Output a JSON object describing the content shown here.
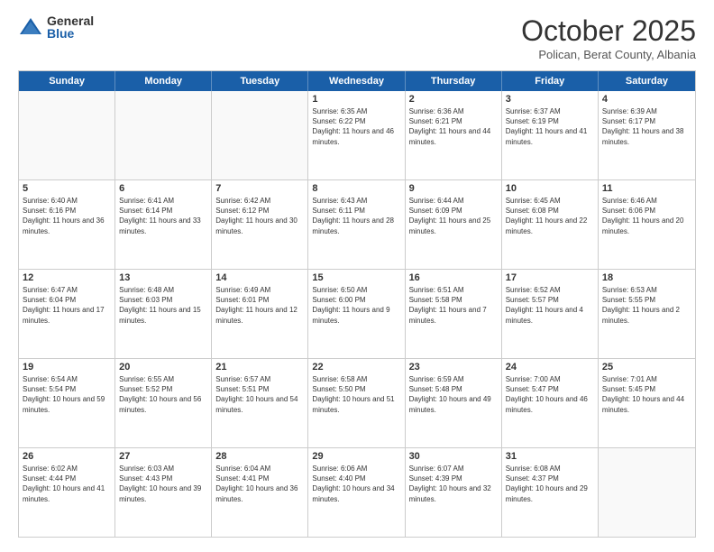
{
  "logo": {
    "general": "General",
    "blue": "Blue"
  },
  "header": {
    "month": "October 2025",
    "location": "Polican, Berat County, Albania"
  },
  "weekdays": [
    "Sunday",
    "Monday",
    "Tuesday",
    "Wednesday",
    "Thursday",
    "Friday",
    "Saturday"
  ],
  "rows": [
    [
      {
        "day": "",
        "info": ""
      },
      {
        "day": "",
        "info": ""
      },
      {
        "day": "",
        "info": ""
      },
      {
        "day": "1",
        "info": "Sunrise: 6:35 AM\nSunset: 6:22 PM\nDaylight: 11 hours and 46 minutes."
      },
      {
        "day": "2",
        "info": "Sunrise: 6:36 AM\nSunset: 6:21 PM\nDaylight: 11 hours and 44 minutes."
      },
      {
        "day": "3",
        "info": "Sunrise: 6:37 AM\nSunset: 6:19 PM\nDaylight: 11 hours and 41 minutes."
      },
      {
        "day": "4",
        "info": "Sunrise: 6:39 AM\nSunset: 6:17 PM\nDaylight: 11 hours and 38 minutes."
      }
    ],
    [
      {
        "day": "5",
        "info": "Sunrise: 6:40 AM\nSunset: 6:16 PM\nDaylight: 11 hours and 36 minutes."
      },
      {
        "day": "6",
        "info": "Sunrise: 6:41 AM\nSunset: 6:14 PM\nDaylight: 11 hours and 33 minutes."
      },
      {
        "day": "7",
        "info": "Sunrise: 6:42 AM\nSunset: 6:12 PM\nDaylight: 11 hours and 30 minutes."
      },
      {
        "day": "8",
        "info": "Sunrise: 6:43 AM\nSunset: 6:11 PM\nDaylight: 11 hours and 28 minutes."
      },
      {
        "day": "9",
        "info": "Sunrise: 6:44 AM\nSunset: 6:09 PM\nDaylight: 11 hours and 25 minutes."
      },
      {
        "day": "10",
        "info": "Sunrise: 6:45 AM\nSunset: 6:08 PM\nDaylight: 11 hours and 22 minutes."
      },
      {
        "day": "11",
        "info": "Sunrise: 6:46 AM\nSunset: 6:06 PM\nDaylight: 11 hours and 20 minutes."
      }
    ],
    [
      {
        "day": "12",
        "info": "Sunrise: 6:47 AM\nSunset: 6:04 PM\nDaylight: 11 hours and 17 minutes."
      },
      {
        "day": "13",
        "info": "Sunrise: 6:48 AM\nSunset: 6:03 PM\nDaylight: 11 hours and 15 minutes."
      },
      {
        "day": "14",
        "info": "Sunrise: 6:49 AM\nSunset: 6:01 PM\nDaylight: 11 hours and 12 minutes."
      },
      {
        "day": "15",
        "info": "Sunrise: 6:50 AM\nSunset: 6:00 PM\nDaylight: 11 hours and 9 minutes."
      },
      {
        "day": "16",
        "info": "Sunrise: 6:51 AM\nSunset: 5:58 PM\nDaylight: 11 hours and 7 minutes."
      },
      {
        "day": "17",
        "info": "Sunrise: 6:52 AM\nSunset: 5:57 PM\nDaylight: 11 hours and 4 minutes."
      },
      {
        "day": "18",
        "info": "Sunrise: 6:53 AM\nSunset: 5:55 PM\nDaylight: 11 hours and 2 minutes."
      }
    ],
    [
      {
        "day": "19",
        "info": "Sunrise: 6:54 AM\nSunset: 5:54 PM\nDaylight: 10 hours and 59 minutes."
      },
      {
        "day": "20",
        "info": "Sunrise: 6:55 AM\nSunset: 5:52 PM\nDaylight: 10 hours and 56 minutes."
      },
      {
        "day": "21",
        "info": "Sunrise: 6:57 AM\nSunset: 5:51 PM\nDaylight: 10 hours and 54 minutes."
      },
      {
        "day": "22",
        "info": "Sunrise: 6:58 AM\nSunset: 5:50 PM\nDaylight: 10 hours and 51 minutes."
      },
      {
        "day": "23",
        "info": "Sunrise: 6:59 AM\nSunset: 5:48 PM\nDaylight: 10 hours and 49 minutes."
      },
      {
        "day": "24",
        "info": "Sunrise: 7:00 AM\nSunset: 5:47 PM\nDaylight: 10 hours and 46 minutes."
      },
      {
        "day": "25",
        "info": "Sunrise: 7:01 AM\nSunset: 5:45 PM\nDaylight: 10 hours and 44 minutes."
      }
    ],
    [
      {
        "day": "26",
        "info": "Sunrise: 6:02 AM\nSunset: 4:44 PM\nDaylight: 10 hours and 41 minutes."
      },
      {
        "day": "27",
        "info": "Sunrise: 6:03 AM\nSunset: 4:43 PM\nDaylight: 10 hours and 39 minutes."
      },
      {
        "day": "28",
        "info": "Sunrise: 6:04 AM\nSunset: 4:41 PM\nDaylight: 10 hours and 36 minutes."
      },
      {
        "day": "29",
        "info": "Sunrise: 6:06 AM\nSunset: 4:40 PM\nDaylight: 10 hours and 34 minutes."
      },
      {
        "day": "30",
        "info": "Sunrise: 6:07 AM\nSunset: 4:39 PM\nDaylight: 10 hours and 32 minutes."
      },
      {
        "day": "31",
        "info": "Sunrise: 6:08 AM\nSunset: 4:37 PM\nDaylight: 10 hours and 29 minutes."
      },
      {
        "day": "",
        "info": ""
      }
    ]
  ]
}
